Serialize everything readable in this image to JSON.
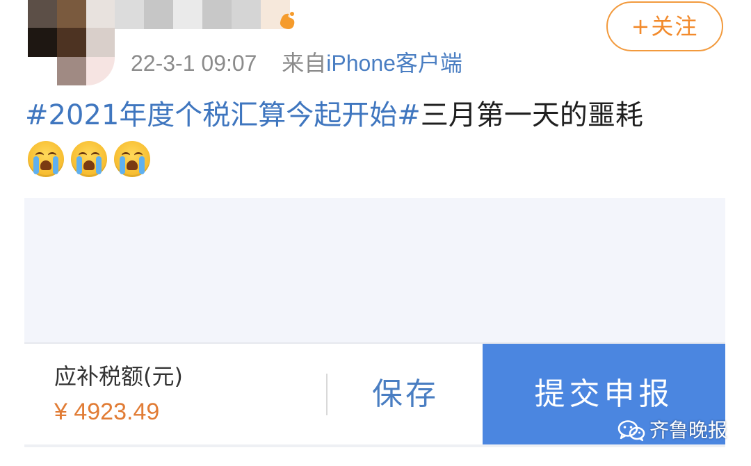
{
  "post": {
    "timestamp": "22-3-1 09:07",
    "source_prefix": "来自",
    "source_client": "iPhone客户端",
    "follow_label": "+关注",
    "hashtag": "#2021年度个税汇算今起开始#",
    "body_text": "三月第一天的噩耗",
    "emojis": [
      "crying-face-icon",
      "crying-face-icon",
      "crying-face-icon"
    ]
  },
  "tax_panel": {
    "label": "应补税额(元)",
    "amount": "¥ 4923.49",
    "save_label": "保存",
    "submit_label": "提交申报"
  },
  "watermark": {
    "icon": "wechat-icon",
    "text": "齐鲁晚报"
  },
  "colors": {
    "hashtag": "#3f76bf",
    "follow_accent": "#f28a2b",
    "amount": "#e17c35",
    "submit_bg": "#4b86e0"
  }
}
